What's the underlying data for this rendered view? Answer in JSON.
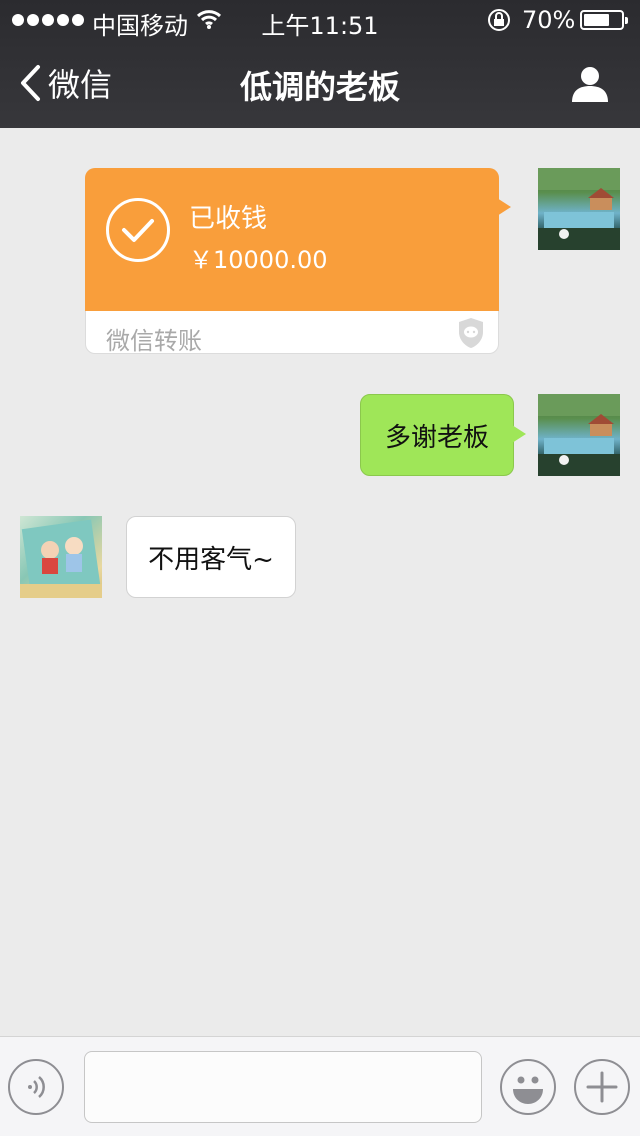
{
  "status_bar": {
    "carrier": "中国移动",
    "time": "上午11:51",
    "battery_percent": "70%",
    "battery_level": 0.7
  },
  "nav": {
    "back_label": "微信",
    "title": "低调的老板"
  },
  "messages": {
    "transfer": {
      "status": "已收钱",
      "amount": "￥10000.00",
      "footer": "微信转账",
      "accent": "#f99e3b"
    },
    "sent_text": "多谢老板",
    "received_text": "不用客气~"
  },
  "colors": {
    "nav_bg": "#2b2b2f",
    "chat_bg": "#ebebeb",
    "sent_bubble": "#9fe658",
    "received_bubble": "#ffffff"
  },
  "icons": {
    "back": "chevron-left-icon",
    "profile": "person-icon",
    "voice": "voice-icon",
    "emoji": "emoji-icon",
    "plus": "plus-icon"
  }
}
